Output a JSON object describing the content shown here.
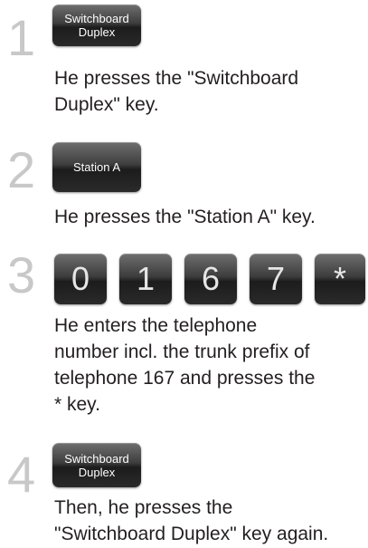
{
  "steps": [
    {
      "number": "1",
      "keys": [
        "Switchboard\nDuplex"
      ],
      "text": "He presses the \"Switchboard\nDuplex\" key."
    },
    {
      "number": "2",
      "keys": [
        "Station A"
      ],
      "text": "He presses the \"Station A\" key."
    },
    {
      "number": "3",
      "keys": [
        "0",
        "1",
        "6",
        "7",
        "*"
      ],
      "text": "He enters the telephone\nnumber incl. the trunk prefix of\ntelephone 167 and presses the\n* key."
    },
    {
      "number": "4",
      "keys": [
        "Switchboard\nDuplex"
      ],
      "text": "Then, he presses the\n\"Switchboard Duplex\" key again."
    }
  ]
}
